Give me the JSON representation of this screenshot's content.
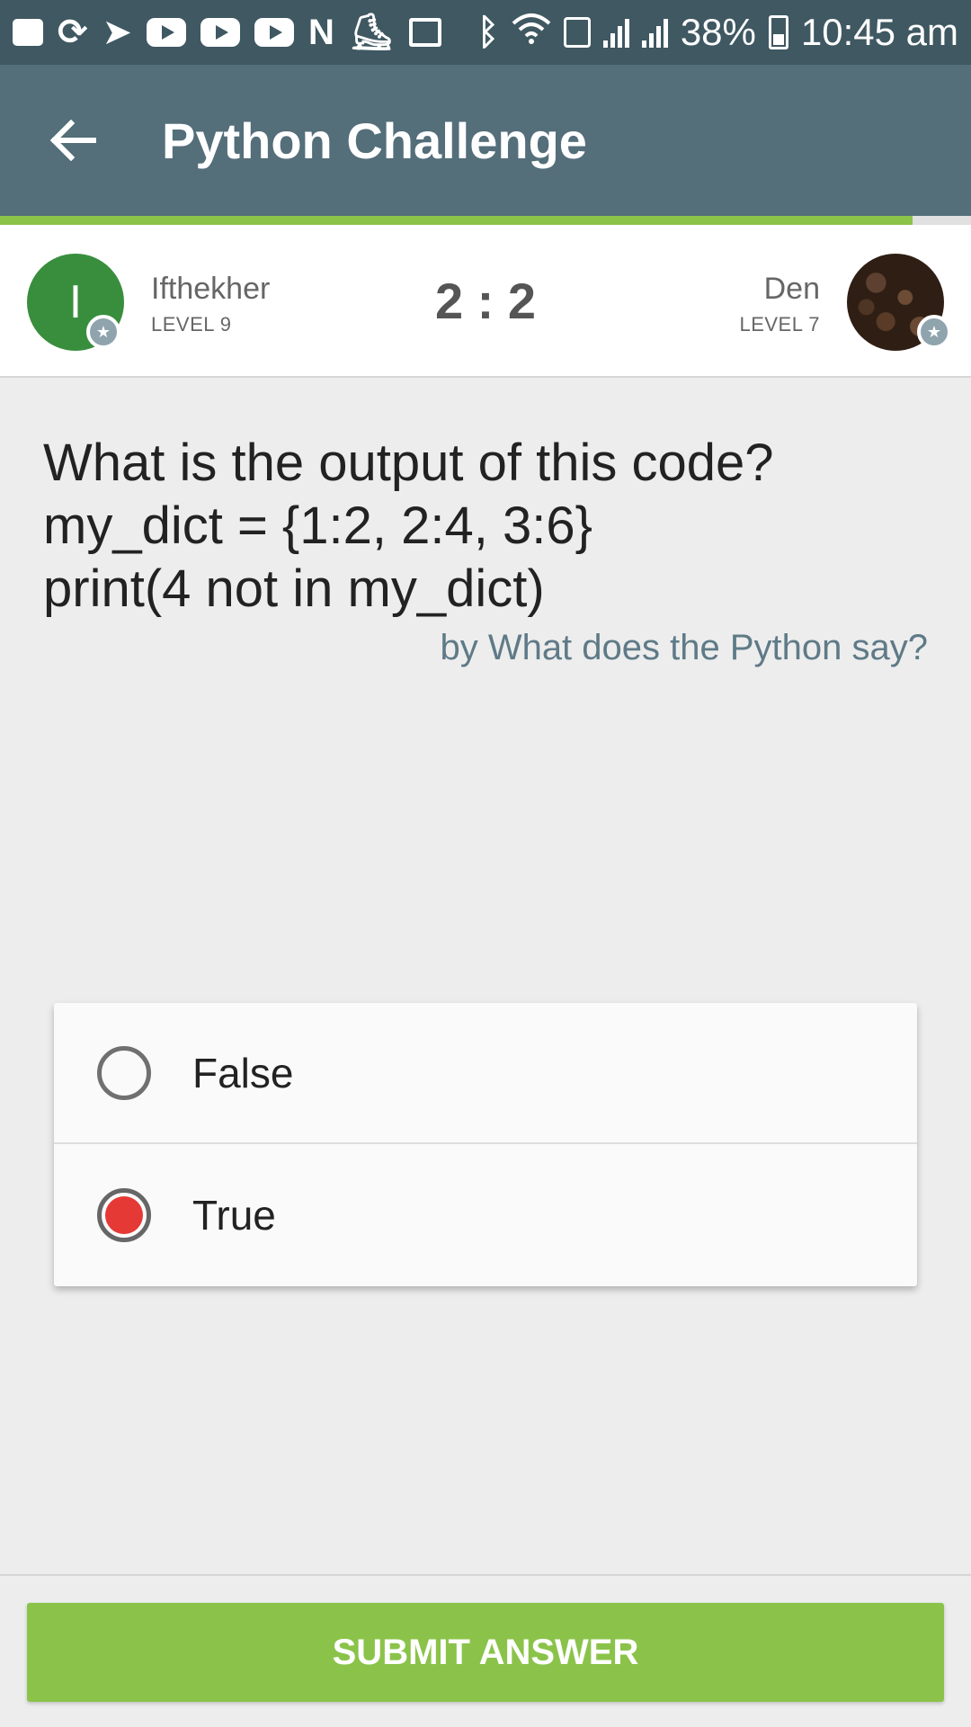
{
  "status_bar": {
    "icons": [
      "message-icon",
      "sync-icon",
      "telegram-icon",
      "youtube-icon",
      "youtube-icon",
      "youtube-icon",
      "n-app-icon",
      "shoe-icon",
      "image-icon",
      "bluetooth-icon",
      "wifi-icon",
      "data-icon",
      "signal-icon",
      "signal-icon",
      "battery-icon"
    ],
    "battery": "38%",
    "time": "10:45 am"
  },
  "app_bar": {
    "title": "Python Challenge",
    "back_icon": "arrow-left-icon"
  },
  "progress": {
    "fraction": 0.94,
    "color": "#8bc34a"
  },
  "players": {
    "left": {
      "initial": "I",
      "name": "Ifthekher",
      "level": "LEVEL 9",
      "avatar_color": "#388e3c"
    },
    "right": {
      "name": "Den",
      "level": "LEVEL 7"
    },
    "score": "2 : 2"
  },
  "question": {
    "lines": [
      "What is the output of this code?",
      "my_dict = {1:2, 2:4, 3:6}",
      "print(4 not in my_dict)"
    ],
    "attribution": "by What does the Python say?"
  },
  "options": [
    {
      "label": "False",
      "selected": false
    },
    {
      "label": "True",
      "selected": true
    }
  ],
  "submit_label": "SUBMIT ANSWER",
  "colors": {
    "primary": "#546e7a",
    "status": "#3f5862",
    "accent": "#8bc34a",
    "selected": "#e53935"
  }
}
